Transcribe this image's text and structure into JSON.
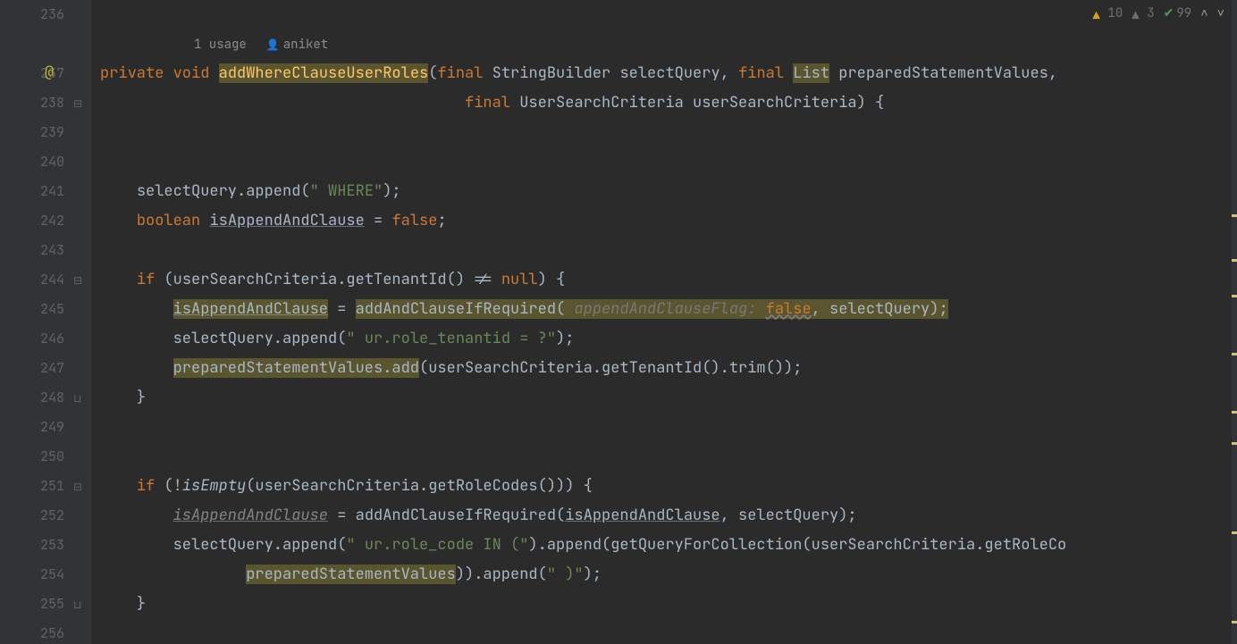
{
  "inspections": {
    "warning_yellow": "10",
    "warning_gray": "3",
    "ok_green": "99"
  },
  "lens": {
    "usages": "1 usage",
    "author": "aniket"
  },
  "lines": {
    "l236": "236",
    "l237": "237",
    "l238": "238",
    "l239": "239",
    "l240": "240",
    "l241": "241",
    "l242": "242",
    "l243": "243",
    "l244": "244",
    "l245": "245",
    "l246": "246",
    "l247": "247",
    "l248": "248",
    "l249": "249",
    "l250": "250",
    "l251": "251",
    "l252": "252",
    "l253": "253",
    "l254": "254",
    "l255": "255",
    "l256": "256"
  },
  "annotation": {
    "override": "@"
  },
  "code": {
    "kw_private": "private",
    "kw_void": "void",
    "method_name": "addWhereClauseUserRoles",
    "kw_final1": "final",
    "t_sb": "StringBuilder",
    "p_selectQuery": "selectQuery",
    "kw_final2": "final",
    "t_list": "List",
    "p_prepared": "preparedStatementValues",
    "kw_final3": "final",
    "t_usc": "UserSearchCriteria",
    "p_usc": "userSearchCriteria",
    "line241_a": "selectQuery.append(",
    "str_where": "\" WHERE\"",
    "line241_b": ");",
    "kw_boolean": "boolean",
    "var_isAppend": "isAppendAndClause",
    "eq_false": " = ",
    "kw_false1": "false",
    "semi": ";",
    "kw_if": "if",
    "line244_cond_a": " (userSearchCriteria.getTenantId() != ",
    "kw_null": "null",
    "line244_cond_b": ") {",
    "line245_lhs": "isAppendAndClause",
    "line245_eq": " = ",
    "line245_call": "addAndClauseIfRequired",
    "line245_open": "(",
    "hint_appendFlag": " appendAndClauseFlag: ",
    "kw_false2": "false",
    "line245_rest": ", selectQuery);",
    "line246_a": "selectQuery.append(",
    "str_tenant": "\" ur.role_tenantid = ?\"",
    "line246_b": ");",
    "line247_a": "preparedStatementValues.add",
    "line247_b": "(userSearchCriteria.getTenantId().trim());",
    "brace_close": "}",
    "line251_a": " (!",
    "call_isEmpty": "isEmpty",
    "line251_b": "(userSearchCriteria.getRoleCodes())) {",
    "line252_lhs": "isAppendAndClause",
    "line252_eq": " = addAndClauseIfRequired(",
    "line252_arg1": "isAppendAndClause",
    "line252_rest": ", selectQuery);",
    "line253_a": "selectQuery.append(",
    "str_rolecode_in": "\" ur.role_code IN (\"",
    "line253_b": ").append(getQueryForCollection(userSearchCriteria.getRoleCo",
    "line254_a": "preparedStatementValues",
    "line254_b": ")).append(",
    "str_close_paren": "\" )\"",
    "line254_c": ");"
  }
}
